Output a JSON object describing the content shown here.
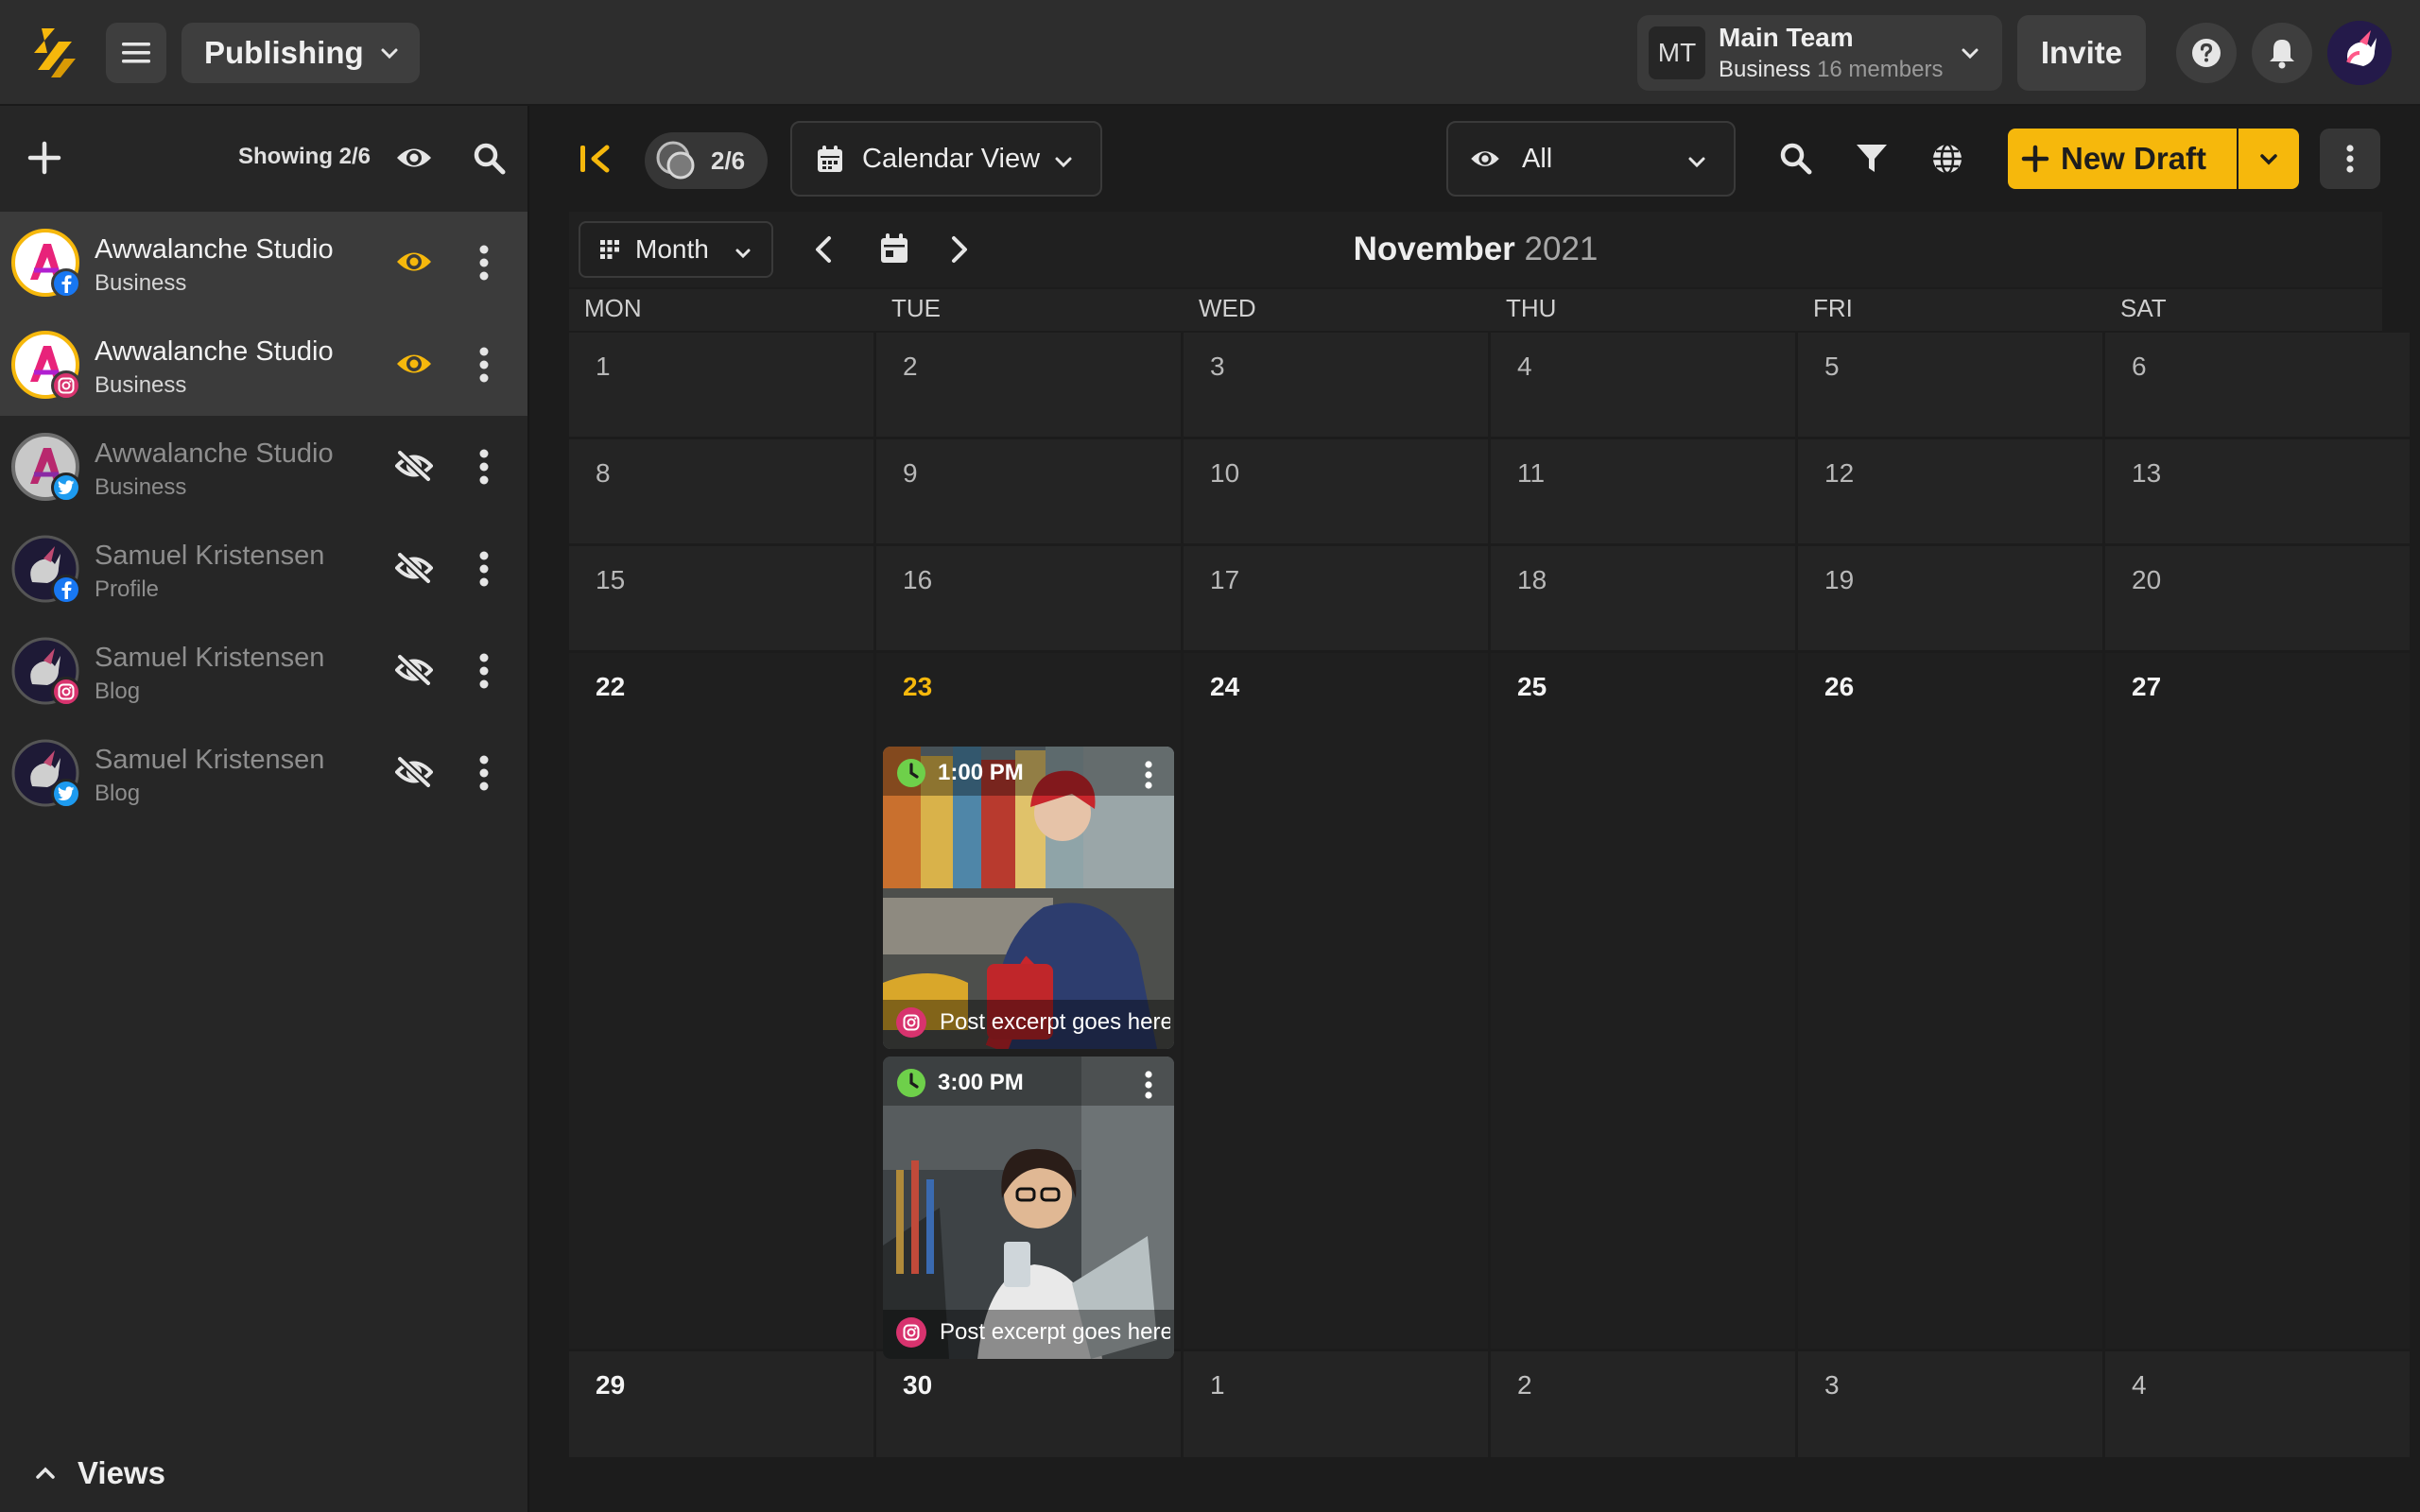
{
  "header": {
    "app_switcher_label": "Publishing",
    "team": {
      "initials": "MT",
      "name": "Main Team",
      "plan": "Business",
      "members": "16 members"
    },
    "invite_label": "Invite"
  },
  "sidebar": {
    "showing": "Showing 2/6",
    "accounts": [
      {
        "name": "Awwalanche Studio",
        "type": "Business",
        "network": "facebook",
        "visible": true
      },
      {
        "name": "Awwalanche Studio",
        "type": "Business",
        "network": "instagram",
        "visible": true
      },
      {
        "name": "Awwalanche Studio",
        "type": "Business",
        "network": "twitter",
        "visible": false
      },
      {
        "name": "Samuel Kristensen",
        "type": "Profile",
        "network": "facebook",
        "visible": false
      },
      {
        "name": "Samuel Kristensen",
        "type": "Blog",
        "network": "instagram",
        "visible": false
      },
      {
        "name": "Samuel Kristensen",
        "type": "Blog",
        "network": "twitter",
        "visible": false
      }
    ],
    "views_label": "Views"
  },
  "toolbar": {
    "account_count": "2/6",
    "view_mode": "Calendar View",
    "status_filter": "All",
    "new_draft_label": "New Draft"
  },
  "calendar": {
    "range_mode": "Month",
    "month": "November",
    "year": "2021",
    "weekdays": [
      "MON",
      "TUE",
      "WED",
      "THU",
      "FRI",
      "SAT"
    ],
    "weeks": [
      [
        "1",
        "2",
        "3",
        "4",
        "5",
        "6"
      ],
      [
        "8",
        "9",
        "10",
        "11",
        "12",
        "13"
      ],
      [
        "15",
        "16",
        "17",
        "18",
        "19",
        "20"
      ],
      [
        "22",
        "23",
        "24",
        "25",
        "26",
        "27"
      ],
      [
        "29",
        "30",
        "1",
        "2",
        "3",
        "4"
      ]
    ],
    "today": "23",
    "posts": [
      {
        "time": "1:00 PM",
        "excerpt": "Post excerpt goes here",
        "network": "instagram"
      },
      {
        "time": "3:00 PM",
        "excerpt": "Post excerpt goes here",
        "network": "instagram"
      }
    ]
  },
  "colors": {
    "accent": "#f6b80c",
    "background": "#1c1c1c",
    "panel": "#262626",
    "scheduled_clock": "#6ed04a",
    "instagram": "#d8336e",
    "facebook": "#1877f2",
    "twitter": "#1d9bf0"
  },
  "icons": {
    "logo": "app-logo",
    "menu": "hamburger-icon",
    "help": "help-icon",
    "notifications": "bell-icon",
    "visible": "eye-icon",
    "hidden": "eye-off-icon"
  }
}
